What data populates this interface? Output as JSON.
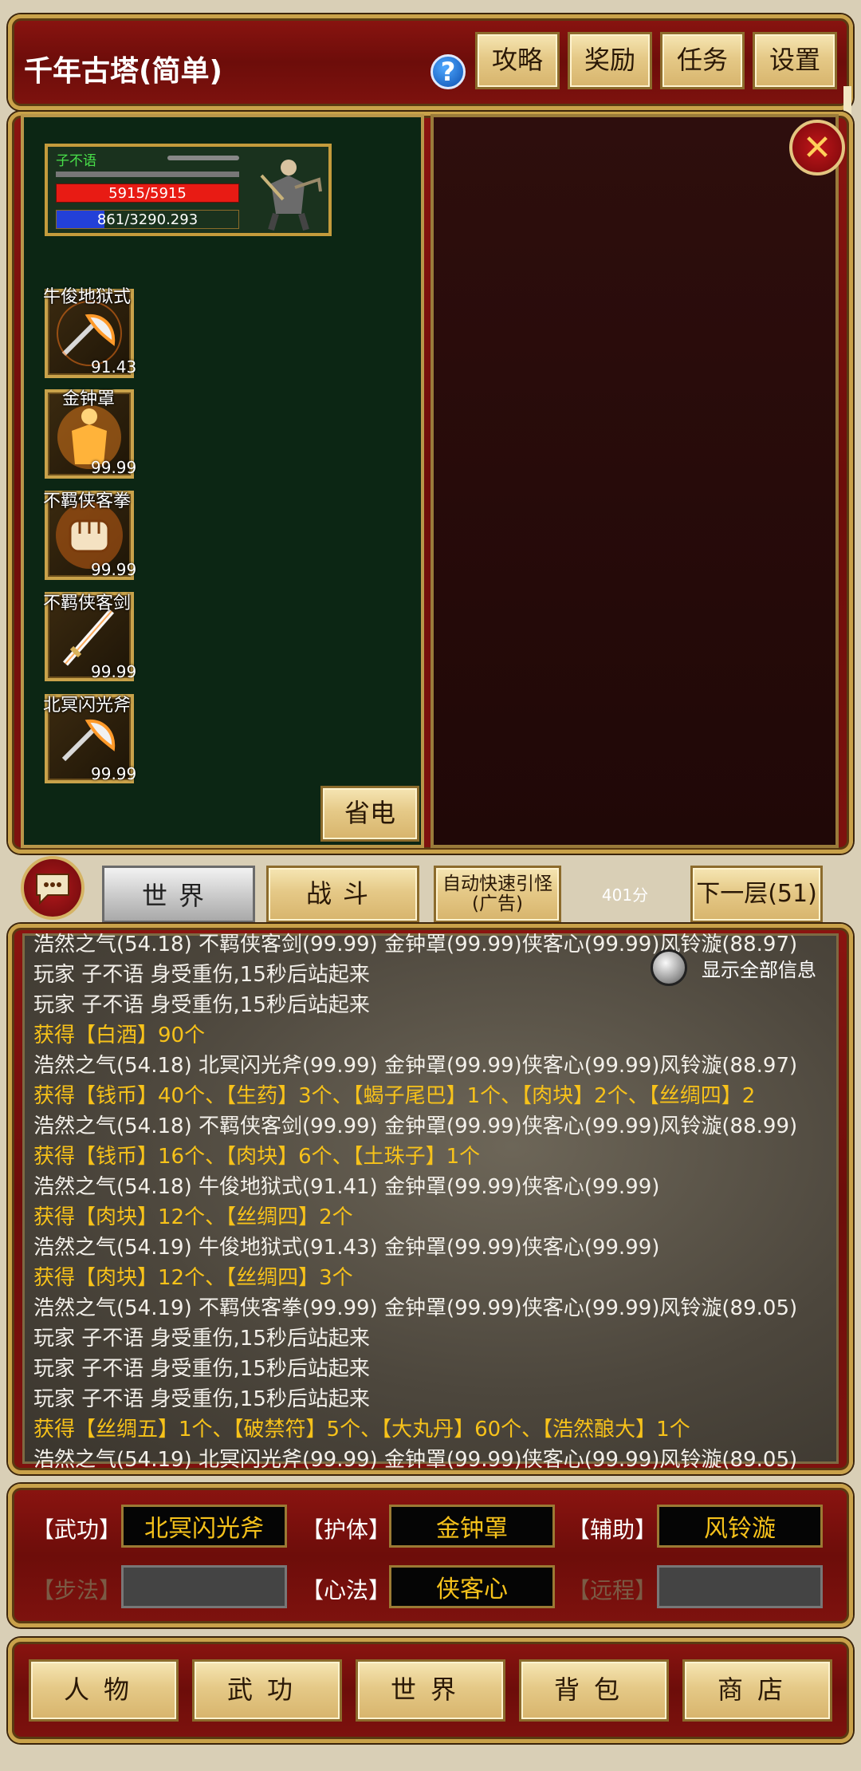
{
  "header": {
    "title": "千年古塔(简单)",
    "help_icon": "?",
    "buttons": [
      "攻略",
      "奖励",
      "任务",
      "设置"
    ]
  },
  "player": {
    "name": "子不语",
    "hp": "5915/5915",
    "mp": "861/3290.293",
    "hp_fraction": 1.0,
    "mp_fraction": 0.262
  },
  "skills": [
    {
      "name": "牛俊地狱式",
      "value": "91.43",
      "icon": "axe-icon"
    },
    {
      "name": "金钟罩",
      "value": "99.99",
      "icon": "golden-bell-icon"
    },
    {
      "name": "不羁侠客拳",
      "value": "99.99",
      "icon": "fist-icon"
    },
    {
      "name": "不羁侠客剑",
      "value": "99.99",
      "icon": "sword-icon"
    },
    {
      "name": "北冥闪光斧",
      "value": "99.99",
      "icon": "axe-icon"
    }
  ],
  "save_power_label": "省电",
  "tabs": {
    "world": "世界",
    "battle": "战斗",
    "auto_lure": "自动快速引怪\n(广告)",
    "score": "401分",
    "next_level": "下一层(51)"
  },
  "log": {
    "show_all_label": "显示全部信息",
    "lines": [
      {
        "text": "浩然之气(54.18) 不羁侠客剑(99.99) 金钟罩(99.99)侠客心(99.99)风铃漩(88.97)",
        "gold": false
      },
      {
        "text": "玩家 子不语 身受重伤,15秒后站起来",
        "gold": false
      },
      {
        "text": "玩家 子不语 身受重伤,15秒后站起来",
        "gold": false
      },
      {
        "text": "获得【白酒】90个",
        "gold": true
      },
      {
        "text": "浩然之气(54.18) 北冥闪光斧(99.99) 金钟罩(99.99)侠客心(99.99)风铃漩(88.97)",
        "gold": false
      },
      {
        "text": "获得【钱币】40个、【生药】3个、【蝎子尾巴】1个、【肉块】2个、【丝绸四】2",
        "gold": true
      },
      {
        "text": "浩然之气(54.18) 不羁侠客剑(99.99) 金钟罩(99.99)侠客心(99.99)风铃漩(88.99)",
        "gold": false
      },
      {
        "text": "获得【钱币】16个、【肉块】6个、【土珠子】1个",
        "gold": true
      },
      {
        "text": "浩然之气(54.18) 牛俊地狱式(91.41) 金钟罩(99.99)侠客心(99.99)",
        "gold": false
      },
      {
        "text": "获得【肉块】12个、【丝绸四】2个",
        "gold": true
      },
      {
        "text": "浩然之气(54.19) 牛俊地狱式(91.43) 金钟罩(99.99)侠客心(99.99)",
        "gold": false
      },
      {
        "text": "获得【肉块】12个、【丝绸四】3个",
        "gold": true
      },
      {
        "text": "浩然之气(54.19) 不羁侠客拳(99.99) 金钟罩(99.99)侠客心(99.99)风铃漩(89.05)",
        "gold": false
      },
      {
        "text": "玩家 子不语 身受重伤,15秒后站起来",
        "gold": false
      },
      {
        "text": "玩家 子不语 身受重伤,15秒后站起来",
        "gold": false
      },
      {
        "text": "玩家 子不语 身受重伤,15秒后站起来",
        "gold": false
      },
      {
        "text": "获得【丝绸五】1个、【破禁符】5个、【大丸丹】60个、【浩然酿大】1个",
        "gold": true
      },
      {
        "text": "浩然之气(54.19) 北冥闪光斧(99.99) 金钟罩(99.99)侠客心(99.99)风铃漩(89.05)",
        "gold": false
      }
    ]
  },
  "equipment": {
    "martial_label": "【武功】",
    "martial_value": "北冥闪光斧",
    "body_label": "【护体】",
    "body_value": "金钟罩",
    "assist_label": "【辅助】",
    "assist_value": "风铃漩",
    "step_label": "【步法】",
    "step_value": "",
    "heart_label": "【心法】",
    "heart_value": "侠客心",
    "ranged_label": "【远程】",
    "ranged_value": ""
  },
  "bottom_nav": [
    "人物",
    "武功",
    "世界",
    "背包",
    "商店"
  ],
  "colors": {
    "gold_text": "#f7c21a",
    "frame_red": "#7e120e",
    "hp_red": "#e81b14",
    "mp_blue": "#2340d8"
  }
}
